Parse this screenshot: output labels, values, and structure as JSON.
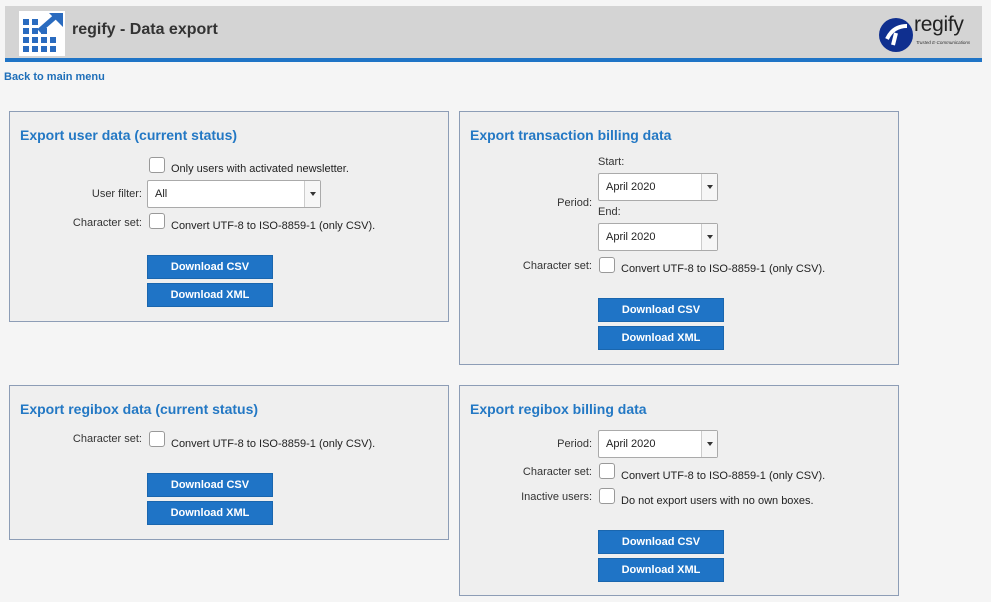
{
  "header": {
    "title": "regify - Data export",
    "brand_name": "regify",
    "brand_tagline": "Trusted E-Communications"
  },
  "nav": {
    "back_label": "Back to main menu"
  },
  "export_user": {
    "title": "Export user data (current status)",
    "newsletter_label": "Only users with activated newsletter.",
    "filter_label": "User filter:",
    "filter_value": "All",
    "charset_label": "Character set:",
    "charset_option": "Convert UTF-8 to ISO-8859-1 (only CSV).",
    "csv_button": "Download CSV",
    "xml_button": "Download XML"
  },
  "export_transaction": {
    "title": "Export transaction billing data",
    "start_label": "Start:",
    "period_label": "Period:",
    "start_value": "April 2020",
    "end_label": "End:",
    "end_value": "April 2020",
    "charset_label": "Character set:",
    "charset_option": "Convert UTF-8 to ISO-8859-1 (only CSV).",
    "csv_button": "Download CSV",
    "xml_button": "Download XML"
  },
  "export_regibox": {
    "title": "Export regibox data (current status)",
    "charset_label": "Character set:",
    "charset_option": "Convert UTF-8 to ISO-8859-1 (only CSV).",
    "csv_button": "Download CSV",
    "xml_button": "Download XML"
  },
  "export_regibox_billing": {
    "title": "Export regibox billing data",
    "period_label": "Period:",
    "period_value": "April 2020",
    "charset_label": "Character set:",
    "charset_option": "Convert UTF-8 to ISO-8859-1 (only CSV).",
    "inactive_label": "Inactive users:",
    "inactive_option": "Do not export users with no own boxes.",
    "csv_button": "Download CSV",
    "xml_button": "Download XML"
  },
  "colors": {
    "accent": "#1f74c6",
    "panel_title": "#2378c4",
    "header_bg": "#d4d4d4"
  }
}
